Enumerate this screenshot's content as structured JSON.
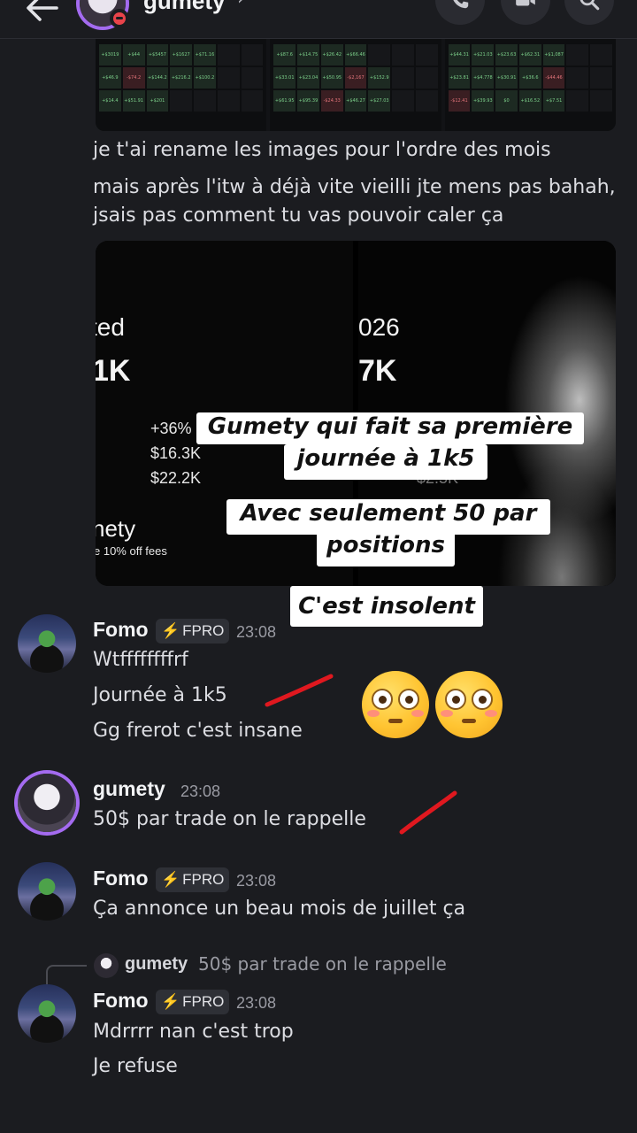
{
  "header": {
    "title": "gumety",
    "back_icon": "arrow-left-icon",
    "chevron": "›",
    "actions": [
      "phone-icon",
      "video-icon",
      "search-icon"
    ]
  },
  "sheet_preview": {
    "panel1_cells": [
      "+$3019",
      "+$44",
      "+$5457",
      "+$1627",
      "+$71.16",
      "",
      "",
      "+$46.9",
      "-$74.2",
      "+$144.2",
      "+$216.2",
      "+$100.2",
      "",
      "",
      "+$14.4",
      "+$51.91",
      "+$201",
      "",
      "",
      "",
      ""
    ],
    "panel2_cells": [
      "+$87.6",
      "+$14.75",
      "+$26.42",
      "+$66.46",
      "",
      "",
      "",
      "+$33.01",
      "+$23.04",
      "+$50.95",
      "-$2,167",
      "+$152.9",
      "",
      "",
      "+$61.95",
      "+$95.39",
      "-$24.33",
      "+$46.27",
      "+$27.03",
      "",
      ""
    ],
    "panel3_cells": [
      "+$44.31",
      "+$21.03",
      "+$23.63",
      "+$62.31",
      "+$1,087",
      "",
      "",
      "+$23.81",
      "+$4.778",
      "+$30.91",
      "+$36.6",
      "-$44.46",
      "",
      "",
      "-$12.41",
      "+$39.93",
      "$0",
      "+$16.52",
      "+$7.51",
      "",
      ""
    ]
  },
  "gumety_first_message": {
    "lines": [
      "je t'ai rename les images pour l'ordre des mois",
      "mais après l'itw à déjà vite vieilli jte mens pas bahah,",
      "jsais pas comment tu vas pouvoir caler ça"
    ]
  },
  "media": {
    "left": {
      "title_partial": "ted",
      "amount_partial": "1K",
      "pct": "+36%",
      "val1": "$16.3K",
      "val2": "$22.2K",
      "brand_partial": "nety",
      "fees": "e 10% off fees"
    },
    "right": {
      "title_partial": "026",
      "amount_partial": "7K",
      "val_partial": "$2.5K"
    },
    "meme_captions": [
      "Gumety qui fait sa première",
      "journée à 1k5",
      "Avec seulement 50 par",
      "positions",
      "C'est insolent"
    ]
  },
  "messages": [
    {
      "user": "Fomo",
      "tag": "FPRO",
      "tag_icon": "⚡",
      "time": "23:08",
      "lines": [
        "Wtffffffffrf",
        "Journée à 1k5",
        "Gg frerot c'est insane"
      ],
      "reactions_emoji": "flushed-face-icon"
    },
    {
      "user": "gumety",
      "time": "23:08",
      "lines": [
        "50$ par trade on le rappelle"
      ]
    },
    {
      "user": "Fomo",
      "tag": "FPRO",
      "tag_icon": "⚡",
      "time": "23:08",
      "lines": [
        "Ça annonce un beau mois de juillet ça"
      ]
    },
    {
      "reply_to": {
        "user": "gumety",
        "text": "50$ par trade on le rappelle"
      },
      "user": "Fomo",
      "tag": "FPRO",
      "tag_icon": "⚡",
      "time": "23:08",
      "lines": [
        "Mdrrrr nan c'est trop",
        "Je refuse"
      ]
    }
  ],
  "colors": {
    "background": "#1b1c20",
    "accent_ring": "#a46bf0",
    "dnd": "#e8434a",
    "annotation": "#e0181f"
  }
}
